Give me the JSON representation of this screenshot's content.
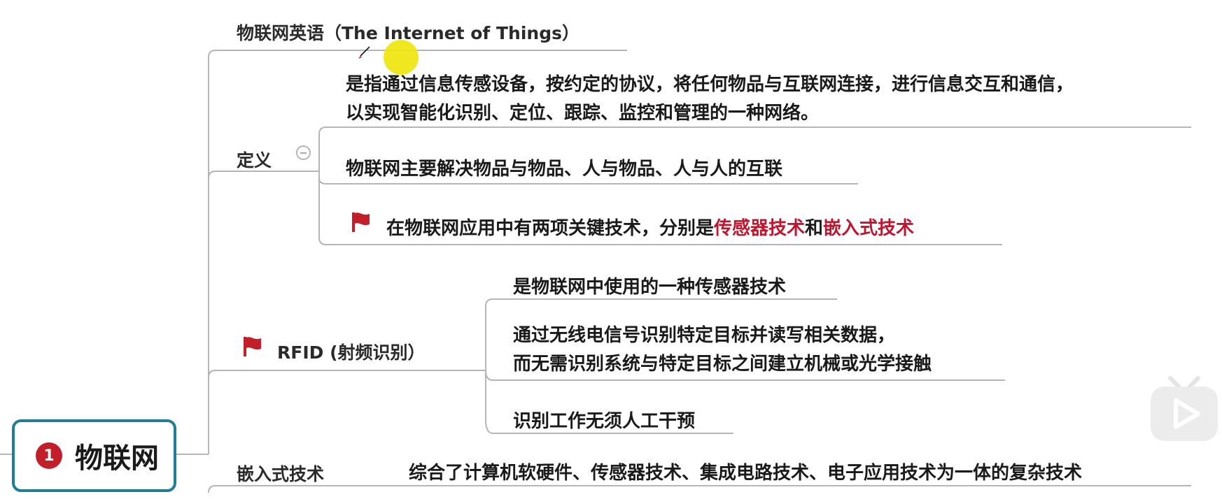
{
  "root": {
    "badge": "1",
    "label": "物联网"
  },
  "branches": {
    "english": {
      "label": "物联网英语（The Internet of Things）"
    },
    "definition": {
      "label": "定义",
      "items": [
        {
          "line1": "是指通过信息传感设备，按约定的协议，将任何物品与互联网连接，进行信息交互和通信，",
          "line2": "以实现智能化识别、定位、跟踪、监控和管理的一种网络。"
        },
        {
          "text": "物联网主要解决物品与物品、人与物品、人与人的互联"
        },
        {
          "prefix": "在物联网应用中有两项关键技术，分别是",
          "tech1": "传感器技术",
          "conj": "和",
          "tech2": "嵌入式技术"
        }
      ]
    },
    "rfid": {
      "label": "RFID (射频识别）",
      "items": [
        {
          "text": "是物联网中使用的一种传感器技术"
        },
        {
          "line1": "通过无线电信号识别特定目标并读写相关数据，",
          "line2": "而无需识别系统与特定目标之间建立机械或光学接触"
        },
        {
          "text": "识别工作无须人工干预"
        }
      ]
    },
    "embedded": {
      "label": "嵌入式技术",
      "detail": "综合了计算机软硬件、传感器技术、集成电路技术、电子应用技术为一体的复杂技术"
    }
  },
  "colors": {
    "accent": "#1f7d96",
    "highlight": "#c0152f",
    "flag": "#c21f2b",
    "line": "#b5b5b5",
    "cursor": "#f0e614"
  },
  "icons": [
    "flag-icon",
    "collapse-icon",
    "cursor-icon",
    "play-icon"
  ]
}
